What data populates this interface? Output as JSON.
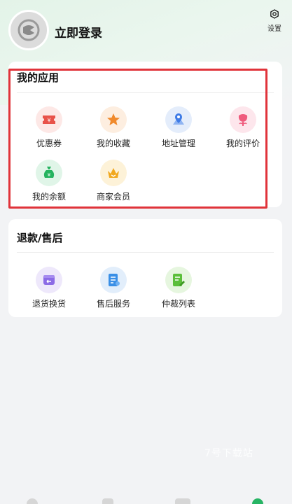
{
  "header": {
    "login_label": "立即登录",
    "settings_label": "设置"
  },
  "my_apps": {
    "title": "我的应用",
    "items": [
      {
        "label": "优惠券",
        "icon": "coupon-icon",
        "color": "#e8524a",
        "bg": "#fde8e6"
      },
      {
        "label": "我的收藏",
        "icon": "star-icon",
        "color": "#f08a2c",
        "bg": "#fdeee0"
      },
      {
        "label": "地址管理",
        "icon": "location-icon",
        "color": "#3e7be6",
        "bg": "#e4edfb"
      },
      {
        "label": "我的评价",
        "icon": "flower-icon",
        "color": "#ef5b7d",
        "bg": "#fde6ec"
      },
      {
        "label": "我的余额",
        "icon": "money-bag-icon",
        "color": "#25b35f",
        "bg": "#e0f5e8"
      },
      {
        "label": "商家会员",
        "icon": "crown-icon",
        "color": "#f1a81e",
        "bg": "#fdf2d8"
      }
    ]
  },
  "refund": {
    "title": "退款/售后",
    "items": [
      {
        "label": "退货换货",
        "icon": "return-box-icon",
        "color": "#8c6be6",
        "bg": "#eee8fb"
      },
      {
        "label": "售后服务",
        "icon": "document-icon",
        "color": "#3a8fe6",
        "bg": "#e2eefb"
      },
      {
        "label": "仲裁列表",
        "icon": "gavel-list-icon",
        "color": "#5bbf3a",
        "bg": "#e6f6df"
      }
    ]
  },
  "watermark": "7号下载站"
}
